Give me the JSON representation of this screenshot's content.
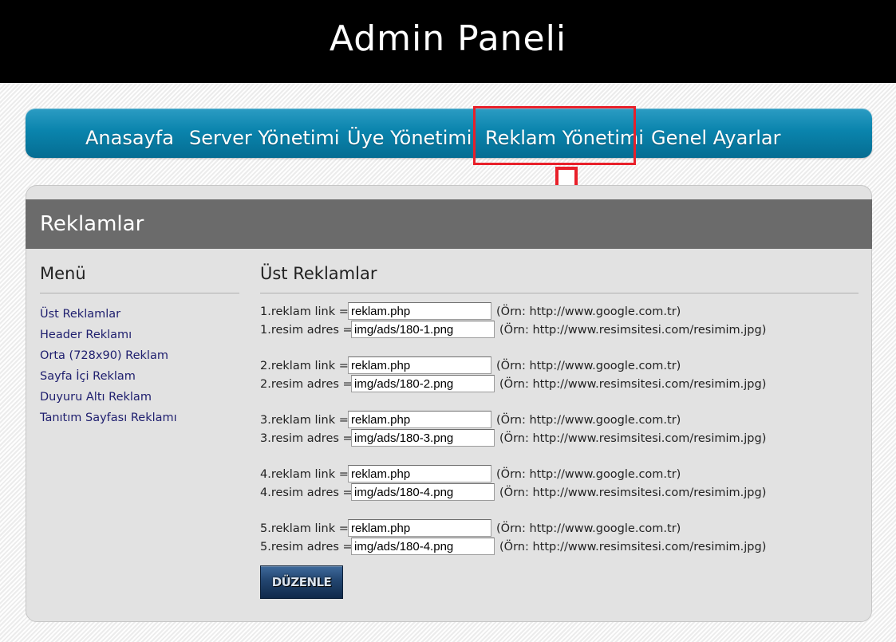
{
  "header": {
    "title": "Admin Paneli"
  },
  "nav": {
    "items": [
      {
        "label": "Anasayfa"
      },
      {
        "label": "Server Yönetimi"
      },
      {
        "label": "Üye Yönetimi"
      },
      {
        "label": "Reklam Yönetimi"
      },
      {
        "label": "Genel Ayarlar"
      }
    ],
    "active": "Reklam Yönetimi"
  },
  "panel": {
    "title": "Reklamlar"
  },
  "sidebar": {
    "heading": "Menü",
    "links": [
      {
        "label": "Üst Reklamlar"
      },
      {
        "label": "Header Reklamı"
      },
      {
        "label": "Orta (728x90) Reklam"
      },
      {
        "label": "Sayfa İçi Reklam"
      },
      {
        "label": "Duyuru Altı Reklam"
      },
      {
        "label": "Tanıtım Sayfası Reklamı"
      }
    ]
  },
  "content": {
    "heading": "Üst Reklamlar",
    "ads": [
      {
        "link_label": "1.reklam link =",
        "link_value": "reklam.php",
        "link_hint": "(Örn: http://www.google.com.tr)",
        "image_label": "1.resim adres =",
        "image_value": "img/ads/180-1.png",
        "image_hint": "(Örn: http://www.resimsitesi.com/resimim.jpg)"
      },
      {
        "link_label": "2.reklam link =",
        "link_value": "reklam.php",
        "link_hint": "(Örn: http://www.google.com.tr)",
        "image_label": "2.resim adres =",
        "image_value": "img/ads/180-2.png",
        "image_hint": "(Örn: http://www.resimsitesi.com/resimim.jpg)"
      },
      {
        "link_label": "3.reklam link =",
        "link_value": "reklam.php",
        "link_hint": "(Örn: http://www.google.com.tr)",
        "image_label": "3.resim adres =",
        "image_value": "img/ads/180-3.png",
        "image_hint": "(Örn: http://www.resimsitesi.com/resimim.jpg)"
      },
      {
        "link_label": "4.reklam link =",
        "link_value": "reklam.php",
        "link_hint": "(Örn: http://www.google.com.tr)",
        "image_label": "4.resim adres =",
        "image_value": "img/ads/180-4.png",
        "image_hint": "(Örn: http://www.resimsitesi.com/resimim.jpg)"
      },
      {
        "link_label": "5.reklam link =",
        "link_value": "reklam.php",
        "link_hint": "(Örn: http://www.google.com.tr)",
        "image_label": "5.resim adres =",
        "image_value": "img/ads/180-4.png",
        "image_hint": "(Örn: http://www.resimsitesi.com/resimim.jpg)"
      }
    ],
    "submit_label": "DÜZENLE"
  },
  "colors": {
    "nav_blue": "#0a84ad",
    "header_gray": "#6b6b6b",
    "annotation_red": "#e8202a",
    "button_navy": "#22456f"
  },
  "icons": {
    "annotation_arrow": "down-arrow-icon"
  }
}
